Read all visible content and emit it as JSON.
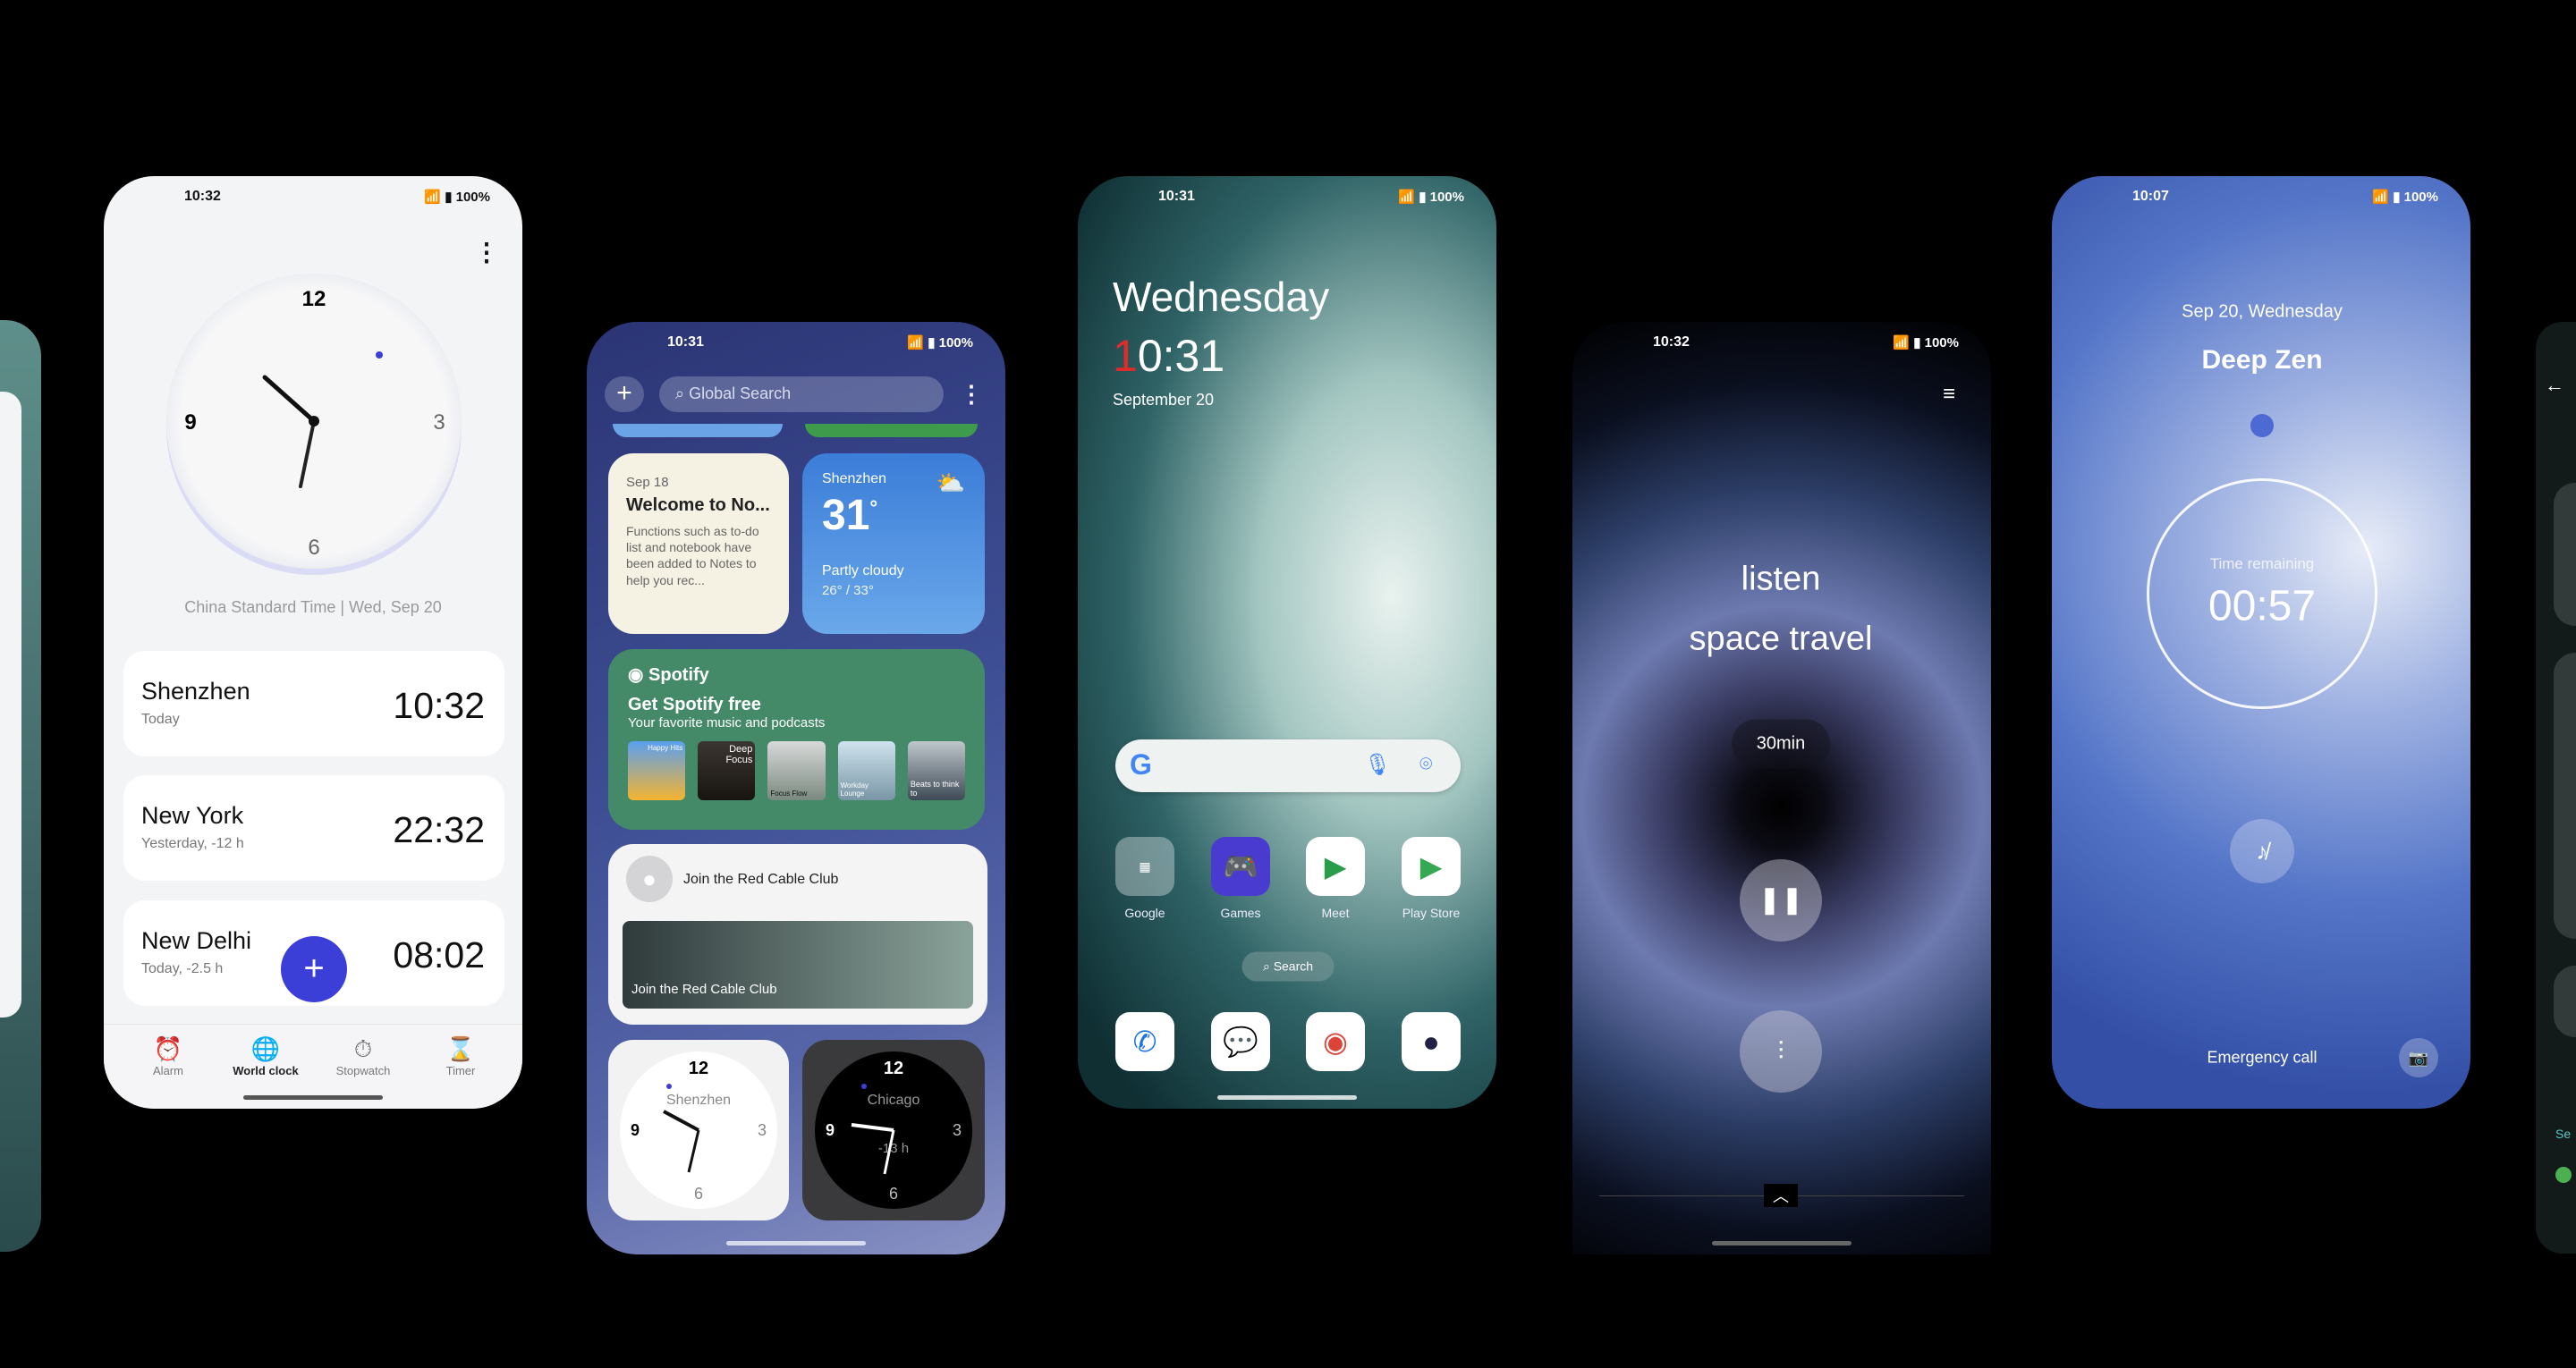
{
  "status_bar": {
    "battery": "100%",
    "icons": [
      "wifi-icon",
      "volte-icon",
      "signal-icon",
      "battery-icon"
    ]
  },
  "clock_app": {
    "time": "10:32",
    "caption": "China Standard Time | Wed, Sep 20",
    "cities": [
      {
        "name": "Shenzhen",
        "sub": "Today",
        "time": "10:32"
      },
      {
        "name": "New York",
        "sub": "Yesterday, -12 h",
        "time": "22:32"
      },
      {
        "name": "New Delhi",
        "sub": "Today, -2.5 h",
        "time": "08:02"
      }
    ],
    "dial": [
      "12",
      "3",
      "6",
      "9"
    ],
    "nav": [
      {
        "label": "Alarm",
        "icon": "alarm-icon"
      },
      {
        "label": "World clock",
        "icon": "globe-icon",
        "active": true
      },
      {
        "label": "Stopwatch",
        "icon": "stopwatch-icon"
      },
      {
        "label": "Timer",
        "icon": "hourglass-icon"
      }
    ],
    "accent": "#3b3fd8"
  },
  "widgets": {
    "time": "10:31",
    "search_placeholder": "Global Search",
    "notes": {
      "date": "Sep 18",
      "title": "Welcome to No...",
      "body": "Functions such as to-do list and notebook have been added to Notes to help you rec..."
    },
    "weather": {
      "city": "Shenzhen",
      "temp": "31",
      "unit": "°",
      "cond": "Partly cloudy",
      "range": "26° / 33°"
    },
    "spotify": {
      "brand": "Spotify",
      "title": "Get Spotify free",
      "subtitle": "Your favorite music and podcasts",
      "playlists": [
        "Happy Hits",
        "Deep Focus",
        "Focus Flow",
        "Workday Lounge",
        "Beats to think to"
      ]
    },
    "club": {
      "title": "Join the Red Cable Club",
      "banner": "Join the Red Cable Club"
    },
    "clocks": [
      {
        "city": "Shenzhen"
      },
      {
        "city": "Chicago",
        "offset": "-13 h"
      }
    ]
  },
  "home": {
    "time": "10:31",
    "day": "Wednesday",
    "clock_first": "1",
    "clock_rest": "0:31",
    "date": "September 20",
    "search": "Search",
    "apps": [
      {
        "label": "Google"
      },
      {
        "label": "Games"
      },
      {
        "label": "Meet"
      },
      {
        "label": "Play Store"
      }
    ],
    "dock": [
      "phone-icon",
      "messages-icon",
      "chrome-icon",
      "camera-icon"
    ]
  },
  "music": {
    "time": "10:32",
    "line1": "listen",
    "line2": "space travel",
    "duration": "30min"
  },
  "zen": {
    "time": "10:07",
    "date": "Sep 20, Wednesday",
    "title": "Deep Zen",
    "remaining_label": "Time remaining",
    "remaining": "00:57",
    "emergency": "Emergency call"
  },
  "right_edge": {
    "link": "Se"
  }
}
